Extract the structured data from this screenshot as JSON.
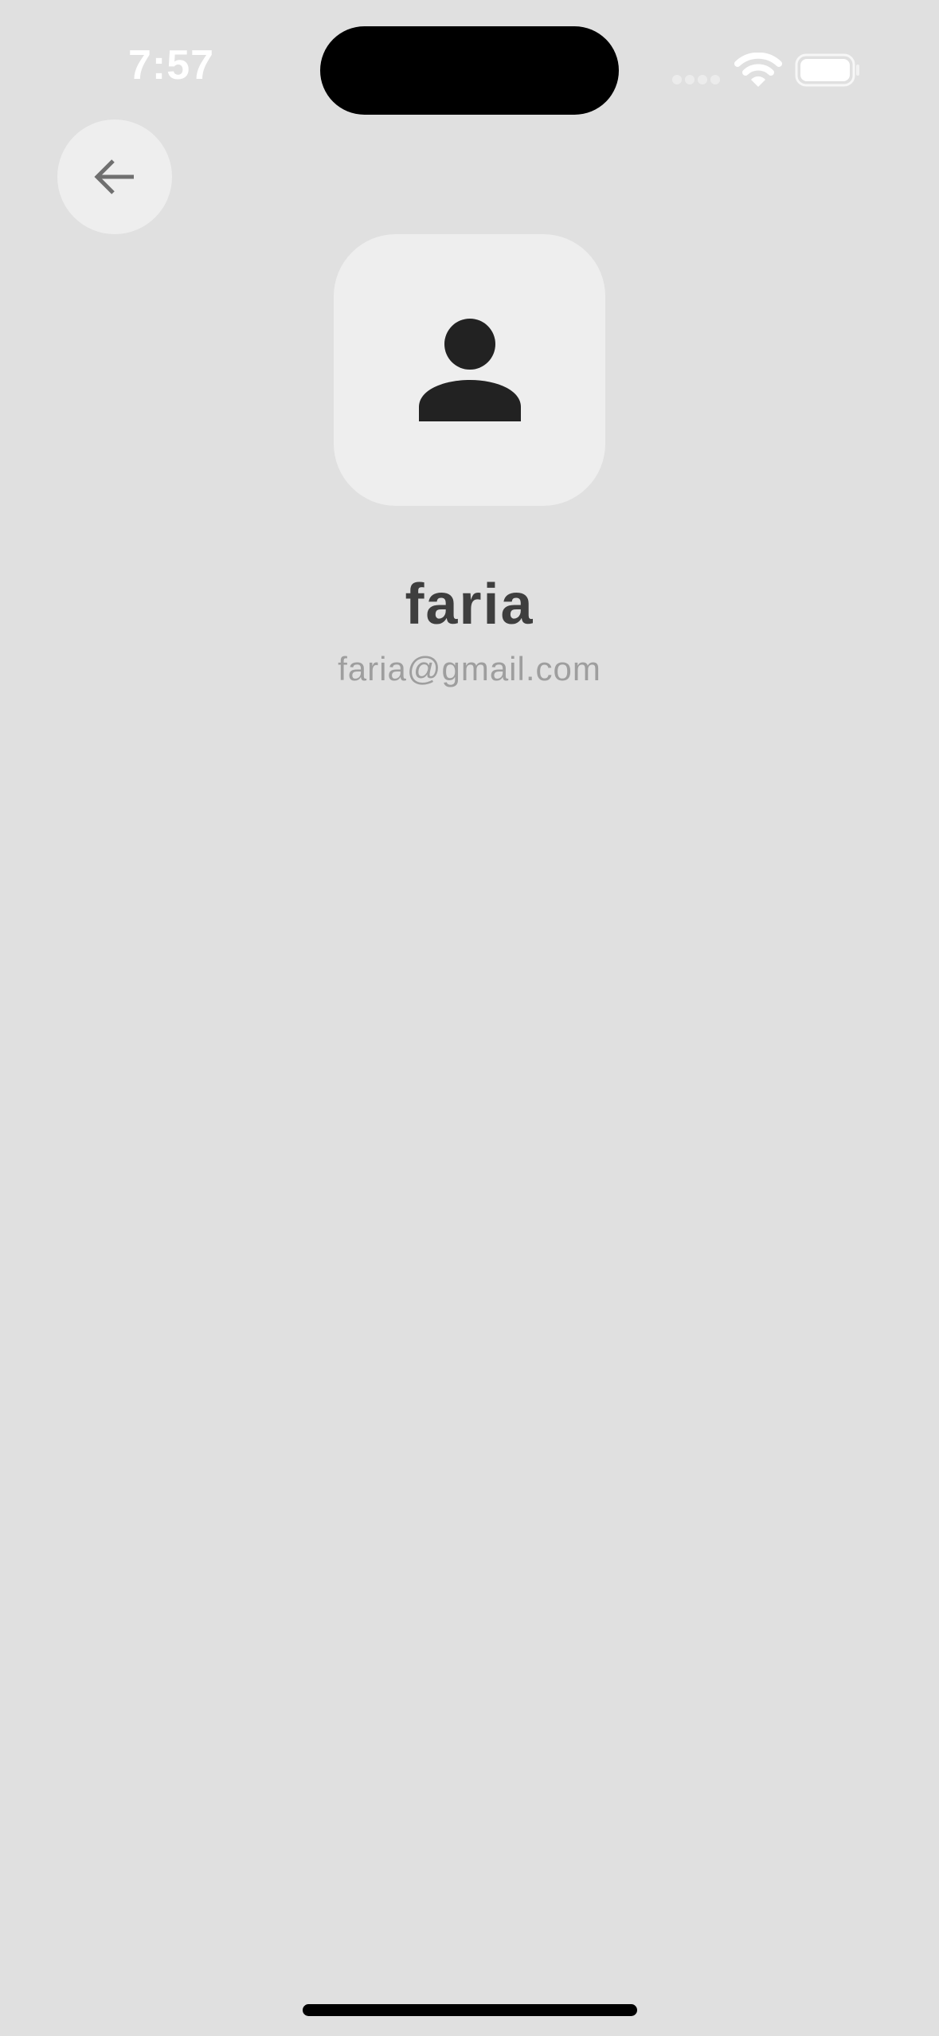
{
  "status_bar": {
    "time": "7:57"
  },
  "header": {
    "back_icon": "arrow-left-icon"
  },
  "profile": {
    "avatar_icon": "person-icon",
    "name": "faria",
    "email": "faria@gmail.com"
  },
  "colors": {
    "background": "#e0e0e0",
    "surface": "#eeeeee",
    "name_text": "#3e3e3e",
    "email_text": "#9e9e9e",
    "icon": "#222222"
  }
}
